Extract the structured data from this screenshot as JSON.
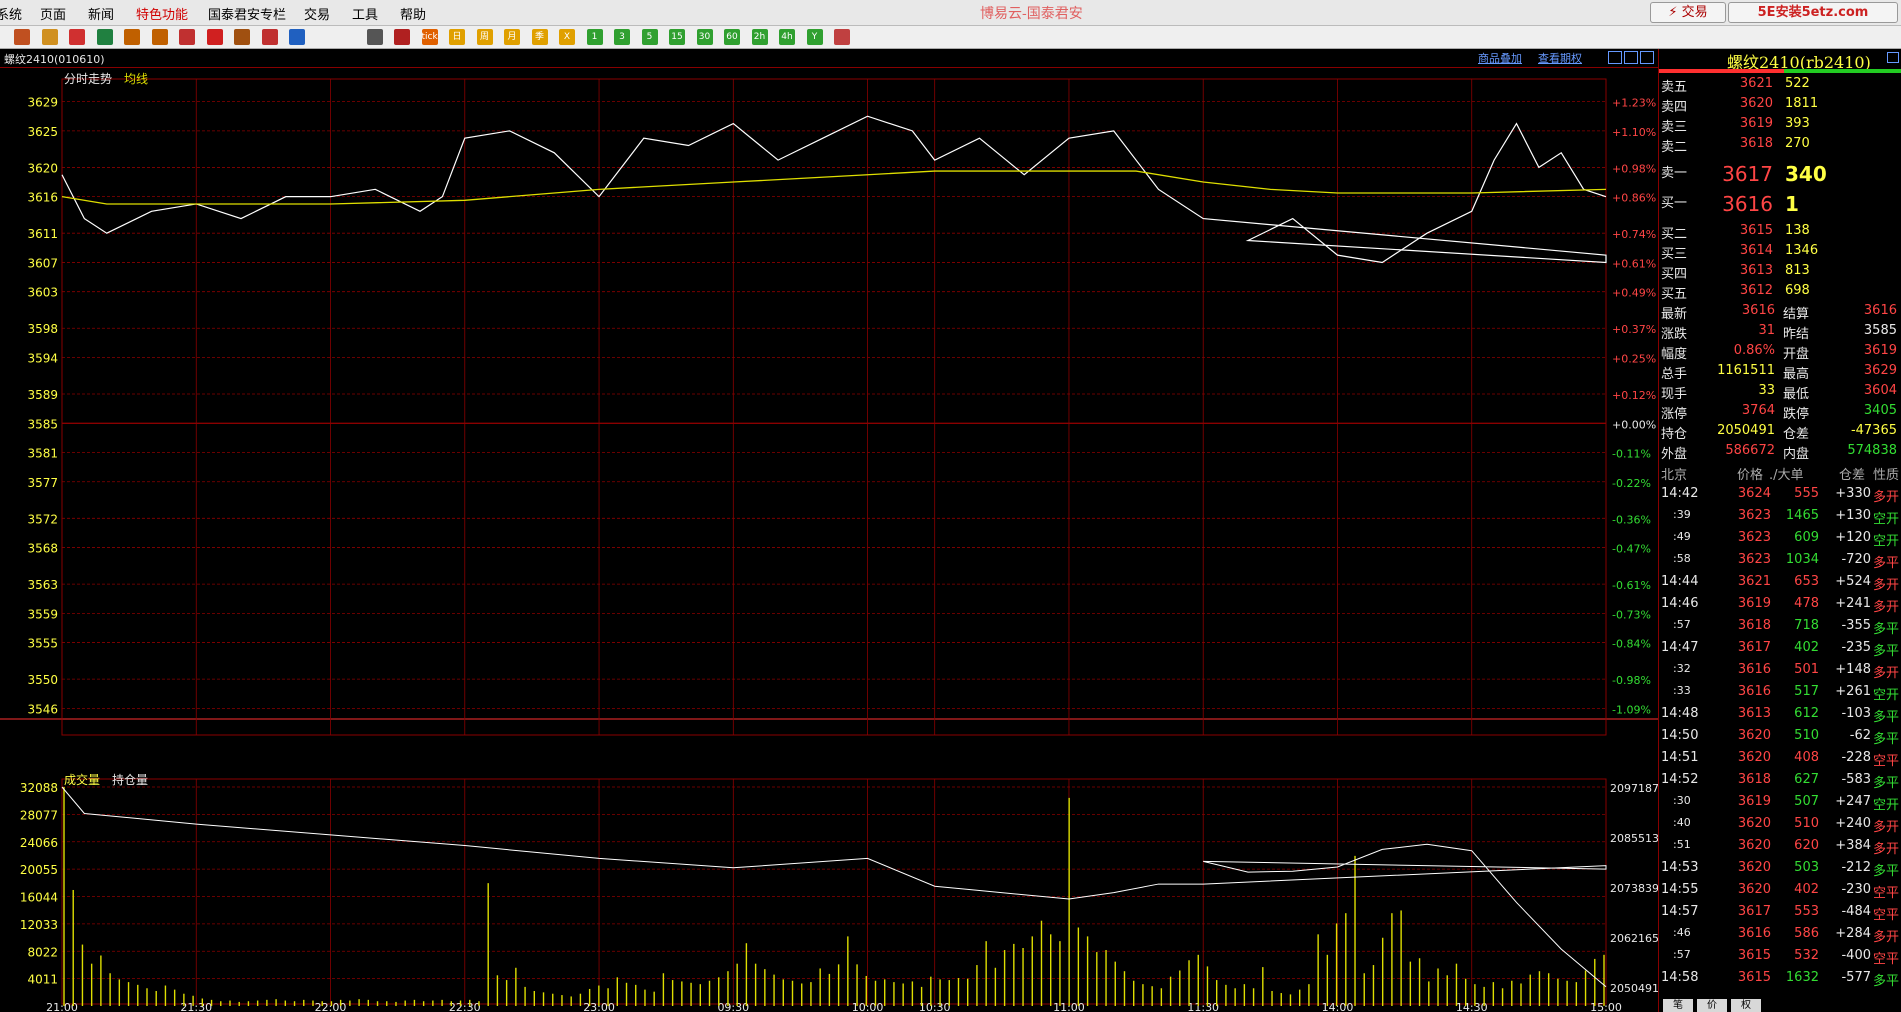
{
  "menu": {
    "items": [
      "系统",
      "页面",
      "新闻",
      "特色功能",
      "国泰君安专栏",
      "交易",
      "工具",
      "帮助"
    ],
    "title": "博易云-国泰君安",
    "trade_label": "交易",
    "logo_text": "5E安装5etz.com"
  },
  "toolbar": {
    "icons": [
      "home-icon",
      "folder-icon",
      "news-icon",
      "refresh-icon",
      "zoom-in-icon",
      "zoom-out-icon",
      "window-icon",
      "pen-icon",
      "hand-icon",
      "filter-icon",
      "signal-icon",
      "table-icon",
      "timechart-icon",
      "kline-icon",
      "day-icon",
      "week-icon",
      "month-icon",
      "season-icon",
      "cross-icon",
      "period-1-icon",
      "period-3-icon",
      "period-5-icon",
      "period-15-icon",
      "period-30-icon",
      "period-60-icon",
      "period-2h-icon",
      "period-4h-icon",
      "year-icon",
      "calc-icon"
    ],
    "labels": [
      "",
      "",
      "",
      "",
      "",
      "",
      "",
      "",
      "",
      "",
      "",
      "",
      "",
      "tick",
      "日",
      "周",
      "月",
      "季",
      "X",
      "1",
      "3",
      "5",
      "15",
      "30",
      "60",
      "2h",
      "4h",
      "Y",
      ""
    ]
  },
  "symbol": {
    "label": "螺纹2410(010610)",
    "add_link": "商品叠加",
    "option_link": "查看期权",
    "header": "螺纹2410(rb2410)"
  },
  "chart_data": [
    {
      "type": "line",
      "title": "分时走势",
      "series": [
        {
          "name": "分时走势",
          "color": "#ffffff",
          "times": [
            "21:00",
            "21:05",
            "21:10",
            "21:20",
            "21:30",
            "21:40",
            "21:50",
            "22:00",
            "22:10",
            "22:20",
            "22:25",
            "22:30",
            "22:40",
            "22:50",
            "23:00",
            "09:10",
            "09:20",
            "09:30",
            "09:40",
            "09:50",
            "10:00",
            "10:10",
            "10:30",
            "10:40",
            "10:50",
            "11:00",
            "11:10",
            "11:20",
            "11:30",
            "11:40",
            "11:50",
            "13:40",
            "13:50",
            "14:00",
            "14:10",
            "14:20",
            "14:30",
            "14:35",
            "14:40",
            "14:45",
            "14:50",
            "14:55",
            "15:00"
          ],
          "values": [
            3619,
            3613,
            3611,
            3614,
            3615,
            3613,
            3616,
            3616,
            3617,
            3614,
            3616,
            3624,
            3625,
            3622,
            3616,
            3624,
            3623,
            3626,
            3621,
            3624,
            3627,
            3625,
            3621,
            3624,
            3619,
            3624,
            3625,
            3617,
            3613,
            3608,
            3607,
            3610,
            3613,
            3608,
            3607,
            3611,
            3614,
            3621,
            3626,
            3620,
            3622,
            3617,
            3616
          ]
        },
        {
          "name": "均线",
          "color": "#dede00",
          "times": [
            "21:00",
            "21:10",
            "21:30",
            "22:00",
            "22:30",
            "23:00",
            "09:30",
            "10:00",
            "10:30",
            "11:00",
            "11:15",
            "11:30",
            "13:45",
            "14:00",
            "14:30",
            "15:00"
          ],
          "values": [
            3616,
            3615,
            3615,
            3615,
            3615.5,
            3617,
            3618,
            3619,
            3619.5,
            3619.5,
            3619.5,
            3618,
            3617,
            3616.5,
            3616.5,
            3617
          ]
        }
      ],
      "ylim": [
        3544,
        3631
      ],
      "yticks": [
        3629,
        3625,
        3620,
        3616,
        3611,
        3607,
        3603,
        3598,
        3594,
        3589,
        3585,
        3581,
        3577,
        3572,
        3568,
        3563,
        3559,
        3555,
        3550,
        3546
      ],
      "pct_ticks": [
        "+1.23%",
        "+1.10%",
        "+0.98%",
        "+0.86%",
        "+0.74%",
        "+0.61%",
        "+0.49%",
        "+0.37%",
        "+0.25%",
        "+0.12%",
        "+0.00%",
        "-0.11%",
        "-0.22%",
        "-0.36%",
        "-0.47%",
        "-0.61%",
        "-0.73%",
        "-0.84%",
        "-0.98%",
        "-1.09%"
      ]
    },
    {
      "type": "bar",
      "title": "成交量",
      "series": [
        {
          "name": "成交量",
          "color": "#dede00",
          "values": [
            32088,
            17000,
            9000,
            6200,
            7400,
            4800,
            3900,
            3500,
            3100,
            2600,
            2200,
            3000,
            2400,
            1800,
            1500,
            1100,
            900,
            700,
            800,
            600,
            700,
            800,
            900,
            1000,
            800,
            700,
            900,
            800,
            700,
            700,
            900,
            800,
            1000,
            900,
            700,
            700,
            600,
            800,
            900,
            700,
            800,
            900,
            700,
            800,
            900,
            700,
            18000,
            4500,
            3800,
            5600,
            2800,
            2200,
            2000,
            1800,
            1600,
            1400,
            1800,
            2500,
            3000,
            2600,
            4200,
            3400,
            3100,
            2400,
            2100,
            4800,
            3800,
            3600,
            3400,
            3200,
            3700,
            4200,
            5100,
            6200,
            9200,
            6200,
            5400,
            4600,
            3900,
            3700,
            3300,
            3500,
            5500,
            4700,
            6100,
            10200,
            6100,
            4400,
            3700,
            3900,
            3500,
            3300,
            3600,
            2800,
            4300,
            3900,
            3800,
            4100,
            4000,
            6000,
            9500,
            5600,
            8200,
            9100,
            8500,
            10200,
            12500,
            10500,
            9500,
            30500,
            11500,
            10200,
            7900,
            8200,
            6500,
            5100,
            3700,
            3200,
            2900,
            2600,
            4300,
            5200,
            6700,
            7500,
            5800,
            3800,
            3100,
            2600,
            3200,
            2600,
            5700,
            2200,
            1900,
            1700,
            2400,
            3200,
            10500,
            7500,
            12100,
            13600,
            22000,
            4800,
            6000,
            10000,
            13600,
            14000,
            6500,
            7000,
            3600,
            5500,
            4500,
            6200,
            4000,
            3200,
            2800,
            3500,
            2600,
            3700,
            3300,
            4600,
            5100,
            4800,
            4000,
            3700,
            3500,
            5200,
            6900,
            7500
          ]
        },
        {
          "name": "持仓量",
          "color": "#ffffff",
          "times": [
            "21:00",
            "21:05",
            "21:30",
            "22:00",
            "22:30",
            "23:00",
            "09:30",
            "10:00",
            "10:30",
            "11:00",
            "11:10",
            "11:20",
            "11:30",
            "11:40",
            "11:50",
            "13:30",
            "13:40",
            "13:50",
            "14:00",
            "14:10",
            "14:20",
            "14:30",
            "14:40",
            "14:50",
            "15:00"
          ],
          "values": [
            2097187,
            2091000,
            2088500,
            2086000,
            2083500,
            2080500,
            2078300,
            2080500,
            2074000,
            2071000,
            2072500,
            2074500,
            2074500,
            2078800,
            2078000,
            2079800,
            2077300,
            2077500,
            2078500,
            2082600,
            2083800,
            2082300,
            2070200,
            2059300,
            2050491
          ]
        }
      ],
      "ylim": [
        0,
        32088
      ],
      "yticks": [
        32088,
        28077,
        24066,
        20055,
        16044,
        12033,
        8022,
        4011
      ],
      "oi_ticks": [
        2097187,
        2085513,
        2073839,
        2062165,
        2050491
      ],
      "oi_lim": [
        2046000,
        2097187
      ],
      "legend": [
        "成交量",
        "持仓量"
      ],
      "x_ticks": [
        "21:00",
        "21:30",
        "22:00",
        "22:30",
        "23:00",
        "09:30",
        "10:00",
        "10:30",
        "11:00",
        "11:30",
        "14:00",
        "14:30",
        "15:00"
      ]
    }
  ],
  "quote": {
    "asks": [
      {
        "label": "卖五",
        "price": "3621",
        "vol": "522"
      },
      {
        "label": "卖四",
        "price": "3620",
        "vol": "1811"
      },
      {
        "label": "卖三",
        "price": "3619",
        "vol": "393"
      },
      {
        "label": "卖二",
        "price": "3618",
        "vol": "270"
      },
      {
        "label": "卖一",
        "price": "3617",
        "vol": "340"
      }
    ],
    "bids": [
      {
        "label": "买一",
        "price": "3616",
        "vol": "1"
      },
      {
        "label": "买二",
        "price": "3615",
        "vol": "138"
      },
      {
        "label": "买三",
        "price": "3614",
        "vol": "1346"
      },
      {
        "label": "买四",
        "price": "3613",
        "vol": "813"
      },
      {
        "label": "买五",
        "price": "3612",
        "vol": "698"
      }
    ],
    "stats": [
      {
        "l1": "最新",
        "v1": "3616",
        "c1": "red",
        "l2": "结算",
        "v2": "3616",
        "c2": "red"
      },
      {
        "l1": "涨跌",
        "v1": "31",
        "c1": "red",
        "l2": "昨结",
        "v2": "3585",
        "c2": "wht"
      },
      {
        "l1": "幅度",
        "v1": "0.86%",
        "c1": "red",
        "l2": "开盘",
        "v2": "3619",
        "c2": "red"
      },
      {
        "l1": "总手",
        "v1": "1161511",
        "c1": "yel",
        "l2": "最高",
        "v2": "3629",
        "c2": "red"
      },
      {
        "l1": "现手",
        "v1": "33",
        "c1": "yel",
        "l2": "最低",
        "v2": "3604",
        "c2": "red"
      },
      {
        "l1": "涨停",
        "v1": "3764",
        "c1": "red",
        "l2": "跌停",
        "v2": "3405",
        "c2": "grn"
      },
      {
        "l1": "持仓",
        "v1": "2050491",
        "c1": "yel",
        "l2": "仓差",
        "v2": "-47365",
        "c2": "yel"
      },
      {
        "l1": "外盘",
        "v1": "586672",
        "c1": "red",
        "l2": "内盘",
        "v2": "574838",
        "c2": "grn"
      }
    ]
  },
  "ticks_header": [
    "北京",
    "价格",
    "./大单",
    "仓差",
    "性质"
  ],
  "ticks": [
    {
      "t": "14:42",
      "p": "3624",
      "v": "555",
      "vc": "red",
      "d": "+330",
      "n": "多开",
      "nc": "red"
    },
    {
      "t": ":39",
      "p": "3623",
      "v": "1465",
      "vc": "grn",
      "d": "+130",
      "n": "空开",
      "nc": "grn"
    },
    {
      "t": ":49",
      "p": "3623",
      "v": "609",
      "vc": "grn",
      "d": "+120",
      "n": "空开",
      "nc": "grn"
    },
    {
      "t": ":58",
      "p": "3623",
      "v": "1034",
      "vc": "grn",
      "d": "-720",
      "n": "多平",
      "nc": "red"
    },
    {
      "t": "14:44",
      "p": "3621",
      "v": "653",
      "vc": "red",
      "d": "+524",
      "n": "多开",
      "nc": "red"
    },
    {
      "t": "14:46",
      "p": "3619",
      "v": "478",
      "vc": "red",
      "d": "+241",
      "n": "多开",
      "nc": "red"
    },
    {
      "t": ":57",
      "p": "3618",
      "v": "718",
      "vc": "grn",
      "d": "-355",
      "n": "多平",
      "nc": "grn"
    },
    {
      "t": "14:47",
      "p": "3617",
      "v": "402",
      "vc": "grn",
      "d": "-235",
      "n": "多平",
      "nc": "grn"
    },
    {
      "t": ":32",
      "p": "3616",
      "v": "501",
      "vc": "red",
      "d": "+148",
      "n": "多开",
      "nc": "red"
    },
    {
      "t": ":33",
      "p": "3616",
      "v": "517",
      "vc": "grn",
      "d": "+261",
      "n": "空开",
      "nc": "grn"
    },
    {
      "t": "14:48",
      "p": "3613",
      "v": "612",
      "vc": "grn",
      "d": "-103",
      "n": "多平",
      "nc": "grn"
    },
    {
      "t": "14:50",
      "p": "3620",
      "v": "510",
      "vc": "grn",
      "d": "-62",
      "n": "多平",
      "nc": "grn"
    },
    {
      "t": "14:51",
      "p": "3620",
      "v": "408",
      "vc": "red",
      "d": "-228",
      "n": "空平",
      "nc": "red"
    },
    {
      "t": "14:52",
      "p": "3618",
      "v": "627",
      "vc": "grn",
      "d": "-583",
      "n": "多平",
      "nc": "grn"
    },
    {
      "t": ":30",
      "p": "3619",
      "v": "507",
      "vc": "grn",
      "d": "+247",
      "n": "空开",
      "nc": "grn"
    },
    {
      "t": ":40",
      "p": "3620",
      "v": "510",
      "vc": "red",
      "d": "+240",
      "n": "多开",
      "nc": "red"
    },
    {
      "t": ":51",
      "p": "3620",
      "v": "620",
      "vc": "red",
      "d": "+384",
      "n": "多开",
      "nc": "red"
    },
    {
      "t": "14:53",
      "p": "3620",
      "v": "503",
      "vc": "grn",
      "d": "-212",
      "n": "多平",
      "nc": "grn"
    },
    {
      "t": "14:55",
      "p": "3620",
      "v": "402",
      "vc": "red",
      "d": "-230",
      "n": "空平",
      "nc": "red"
    },
    {
      "t": "14:57",
      "p": "3617",
      "v": "553",
      "vc": "red",
      "d": "-484",
      "n": "空平",
      "nc": "red"
    },
    {
      "t": ":46",
      "p": "3616",
      "v": "586",
      "vc": "red",
      "d": "+284",
      "n": "多开",
      "nc": "red"
    },
    {
      "t": ":57",
      "p": "3615",
      "v": "532",
      "vc": "red",
      "d": "-400",
      "n": "空平",
      "nc": "red"
    },
    {
      "t": "14:58",
      "p": "3615",
      "v": "1632",
      "vc": "grn",
      "d": "-577",
      "n": "多平",
      "nc": "grn"
    }
  ],
  "bottom_tabs": [
    "笔",
    "价",
    "权"
  ],
  "colors": {
    "grid": "#8a0000",
    "up": "#ff4545",
    "down": "#33dd33",
    "text_yellow": "#ffff44"
  }
}
